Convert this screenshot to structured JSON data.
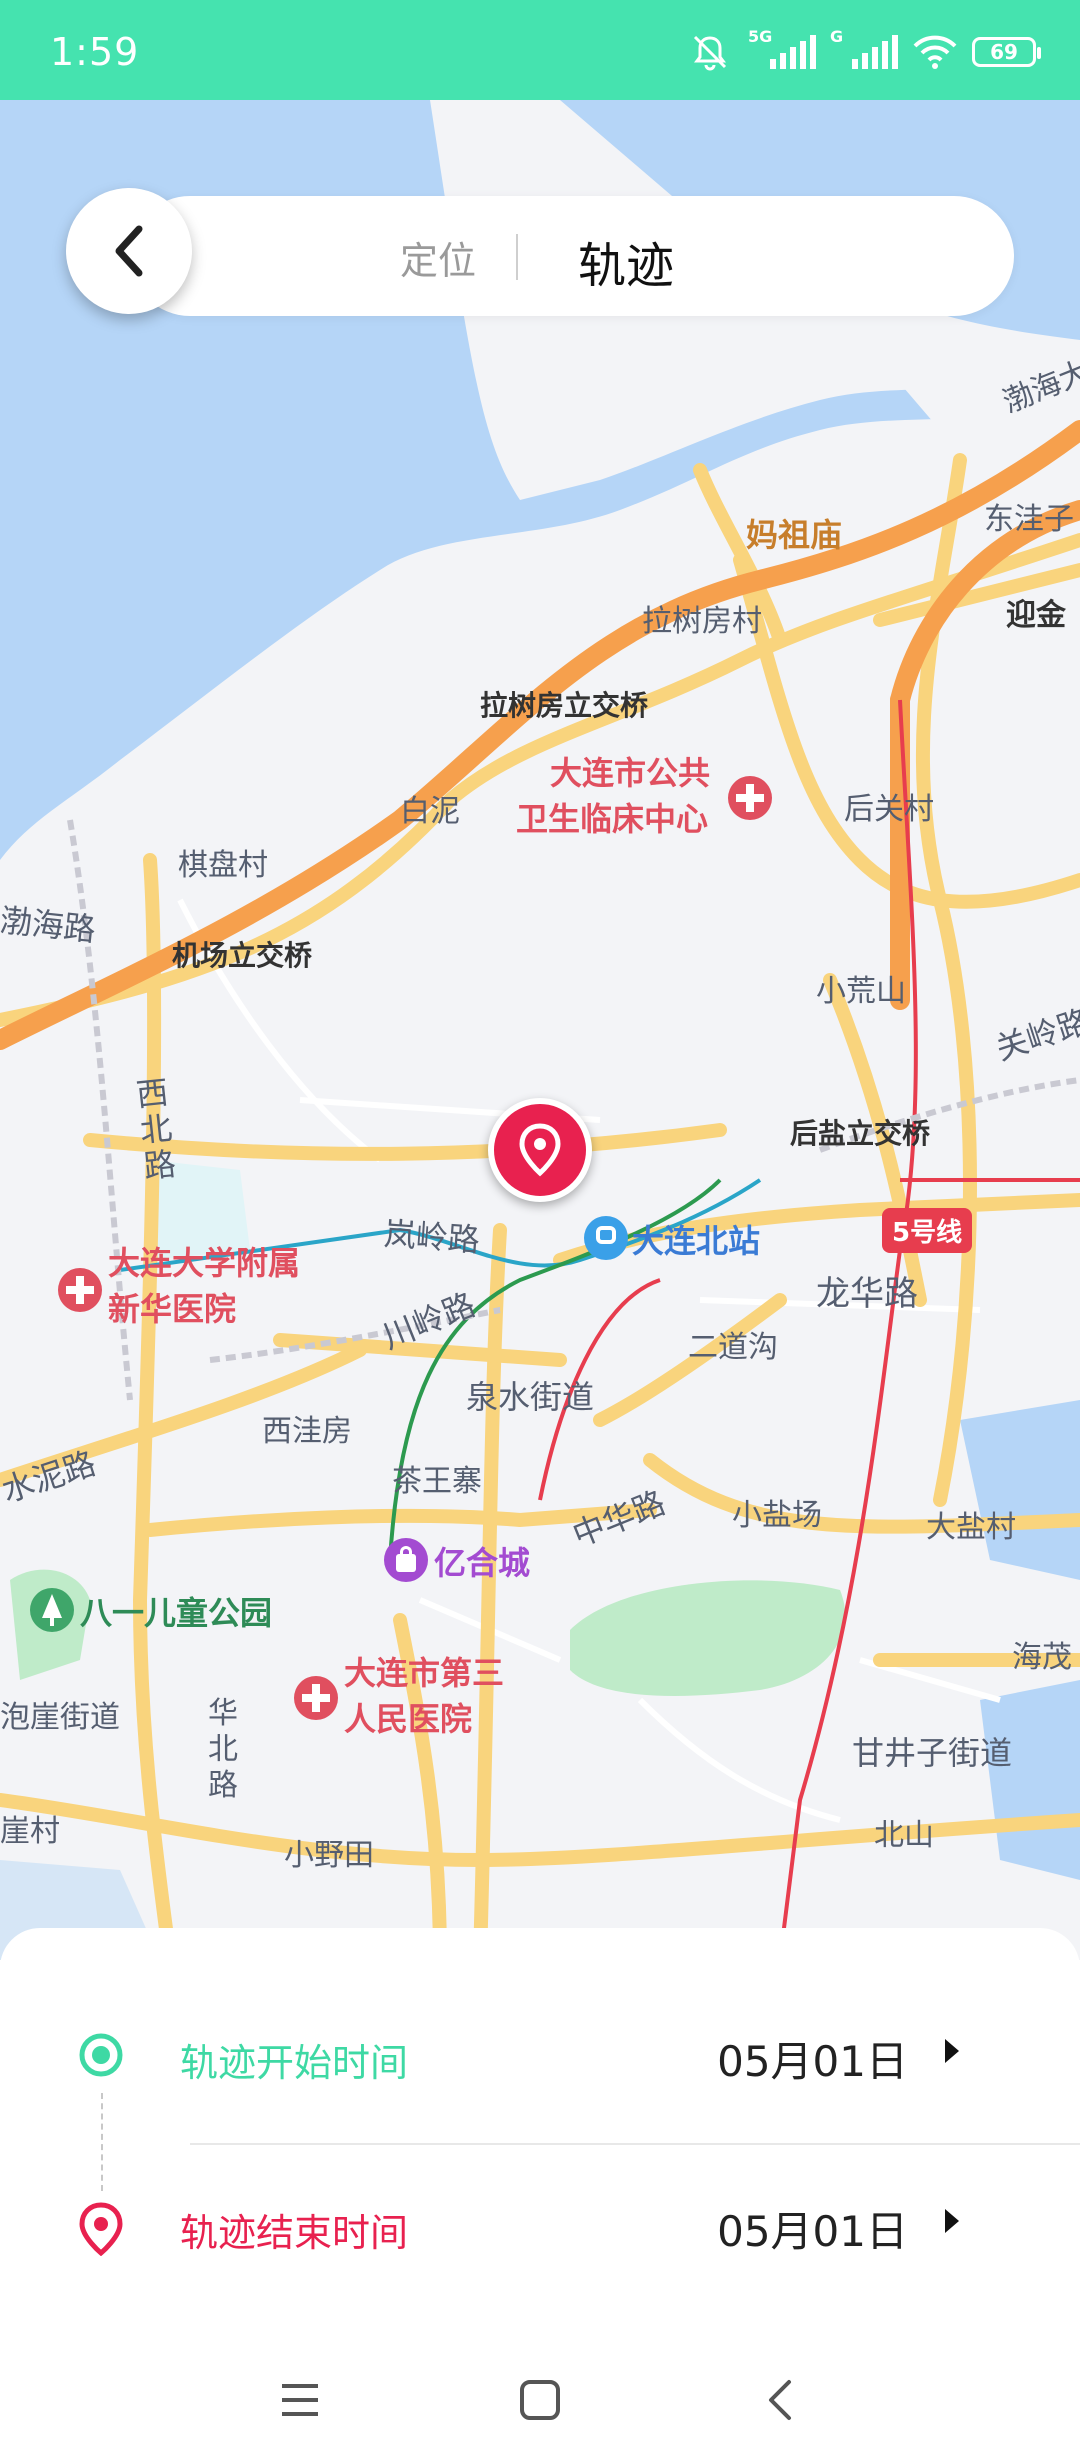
{
  "status_bar": {
    "time": "1:59",
    "signal_1_label": "5G",
    "signal_2_label": "G",
    "battery": "69"
  },
  "header": {
    "tab_locate": "定位",
    "tab_track": "轨迹"
  },
  "map": {
    "labels": {
      "mazu_temple": "妈祖庙",
      "dongwazi": "东洼子",
      "bohai_top": "渤海大",
      "yingjin": "迎金",
      "lashufang_village": "拉树房村",
      "lashufang_interchange": "拉树房立交桥",
      "baini": "白泥",
      "hospital_public_1": "大连市公共",
      "hospital_public_2": "卫生临床中心",
      "houguan_village": "后关村",
      "qipan_village": "棋盘村",
      "bohai_road": "渤海路",
      "airport_interchange": "机场立交桥",
      "xiaohuangshan": "小荒山",
      "guanling_road": "关岭路",
      "xibei_road": "西北路",
      "houyan_interchange": "后盐立交桥",
      "lanling_road": "岚岭路",
      "dalian_north_station": "大连北站",
      "line5": "5号线",
      "hospital_xinhua_1": "大连大学附属",
      "hospital_xinhua_2": "新华医院",
      "chuanling_road": "川岭路",
      "longhua_road": "龙华路",
      "erdaogou": "二道沟",
      "quanshui_street": "泉水街道",
      "xiwafang": "西洼房",
      "shuini_road": "水泥路",
      "chawangzhai": "茶王寨",
      "zhonghua_road": "中华路",
      "xiaoyanchang": "小盐场",
      "dayan_village": "大盐村",
      "yihe_city": "亿合城",
      "bayi_park": "八一儿童公园",
      "haimao": "海茂",
      "hospital_third_1": "大连市第三",
      "hospital_third_2": "人民医院",
      "paoya_street": "泡崖街道",
      "huabei_road": "华北路",
      "ganjingzi_street": "甘井子街道",
      "yacun": "崖村",
      "xiaoyetian": "小野田",
      "beishan": "北山"
    }
  },
  "track_panel": {
    "start_label": "轨迹开始时间",
    "start_value": "05月01日",
    "end_label": "轨迹结束时间",
    "end_value": "05月01日"
  },
  "colors": {
    "accent_green": "#45E3AF",
    "start_green": "#3ED9A4",
    "end_red": "#E8214F",
    "water": "#B5D5F7",
    "road_yellow": "#F9D47D",
    "road_orange": "#F6A04D"
  }
}
